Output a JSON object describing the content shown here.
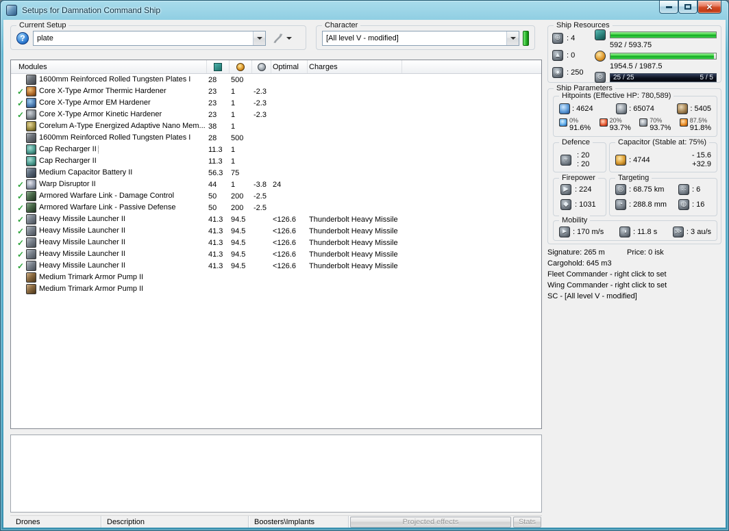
{
  "window": {
    "title": "Setups for Damnation Command Ship"
  },
  "setup_bar": {
    "current_setup_label": "Current Setup",
    "setup_value": "plate",
    "character_label": "Character",
    "character_value": "[All level V - modified]"
  },
  "modules": {
    "columns": {
      "name": "Modules",
      "optimal": "Optimal",
      "charges": "Charges"
    },
    "rows": [
      {
        "active": false,
        "icon": "armor-plate",
        "name": "1600mm Reinforced Rolled Tungsten Plates I",
        "cpu": "28",
        "pg": "500",
        "cap": "",
        "optimal": "",
        "charge": "",
        "focused": false
      },
      {
        "active": true,
        "icon": "hardener-thermic",
        "name": "Core X-Type Armor Thermic Hardener",
        "cpu": "23",
        "pg": "1",
        "cap": "-2.3",
        "optimal": "",
        "charge": "",
        "focused": false
      },
      {
        "active": true,
        "icon": "hardener-em",
        "name": "Core X-Type Armor EM Hardener",
        "cpu": "23",
        "pg": "1",
        "cap": "-2.3",
        "optimal": "",
        "charge": "",
        "focused": false
      },
      {
        "active": true,
        "icon": "hardener-kinetic",
        "name": "Core X-Type Armor Kinetic Hardener",
        "cpu": "23",
        "pg": "1",
        "cap": "-2.3",
        "optimal": "",
        "charge": "",
        "focused": false
      },
      {
        "active": false,
        "icon": "eanm",
        "name": "Corelum A-Type Energized Adaptive Nano Mem...",
        "cpu": "38",
        "pg": "1",
        "cap": "",
        "optimal": "",
        "charge": "",
        "focused": false
      },
      {
        "active": false,
        "icon": "armor-plate",
        "name": "1600mm Reinforced Rolled Tungsten Plates I",
        "cpu": "28",
        "pg": "500",
        "cap": "",
        "optimal": "",
        "charge": "",
        "focused": false
      },
      {
        "active": false,
        "icon": "cap-recharger",
        "name": "Cap Recharger II",
        "cpu": "11.3",
        "pg": "1",
        "cap": "",
        "optimal": "",
        "charge": "",
        "focused": true
      },
      {
        "active": false,
        "icon": "cap-recharger",
        "name": "Cap Recharger II",
        "cpu": "11.3",
        "pg": "1",
        "cap": "",
        "optimal": "",
        "charge": "",
        "focused": false
      },
      {
        "active": false,
        "icon": "cap-battery",
        "name": "Medium Capacitor Battery II",
        "cpu": "56.3",
        "pg": "75",
        "cap": "",
        "optimal": "",
        "charge": "",
        "focused": false
      },
      {
        "active": true,
        "icon": "warp-disruptor",
        "name": "Warp Disruptor II",
        "cpu": "44",
        "pg": "1",
        "cap": "-3.8",
        "optimal": "24",
        "charge": "",
        "focused": false
      },
      {
        "active": true,
        "icon": "warfare-link",
        "name": "Armored Warfare Link - Damage Control",
        "cpu": "50",
        "pg": "200",
        "cap": "-2.5",
        "optimal": "",
        "charge": "",
        "focused": false
      },
      {
        "active": true,
        "icon": "warfare-link",
        "name": "Armored Warfare Link - Passive Defense",
        "cpu": "50",
        "pg": "200",
        "cap": "-2.5",
        "optimal": "",
        "charge": "",
        "focused": false
      },
      {
        "active": true,
        "icon": "missile-launcher",
        "name": "Heavy Missile Launcher II",
        "cpu": "41.3",
        "pg": "94.5",
        "cap": "",
        "optimal": "<126.6",
        "charge": "Thunderbolt Heavy Missile",
        "focused": false
      },
      {
        "active": true,
        "icon": "missile-launcher",
        "name": "Heavy Missile Launcher II",
        "cpu": "41.3",
        "pg": "94.5",
        "cap": "",
        "optimal": "<126.6",
        "charge": "Thunderbolt Heavy Missile",
        "focused": false
      },
      {
        "active": true,
        "icon": "missile-launcher",
        "name": "Heavy Missile Launcher II",
        "cpu": "41.3",
        "pg": "94.5",
        "cap": "",
        "optimal": "<126.6",
        "charge": "Thunderbolt Heavy Missile",
        "focused": false
      },
      {
        "active": true,
        "icon": "missile-launcher",
        "name": "Heavy Missile Launcher II",
        "cpu": "41.3",
        "pg": "94.5",
        "cap": "",
        "optimal": "<126.6",
        "charge": "Thunderbolt Heavy Missile",
        "focused": false
      },
      {
        "active": true,
        "icon": "missile-launcher",
        "name": "Heavy Missile Launcher II",
        "cpu": "41.3",
        "pg": "94.5",
        "cap": "",
        "optimal": "<126.6",
        "charge": "Thunderbolt Heavy Missile",
        "focused": false
      },
      {
        "active": false,
        "icon": "rig",
        "name": "Medium Trimark Armor Pump II",
        "cpu": "",
        "pg": "",
        "cap": "",
        "optimal": "",
        "charge": "",
        "focused": false
      },
      {
        "active": false,
        "icon": "rig",
        "name": "Medium Trimark Armor Pump II",
        "cpu": "",
        "pg": "",
        "cap": "",
        "optimal": "",
        "charge": "",
        "focused": false
      }
    ]
  },
  "ship_resources": {
    "label": "Ship Resources",
    "turret_hardpoints": ": 4",
    "launcher_hardpoints": ": 0",
    "calibration": ": 250",
    "cpu_text": "592 / 593.75",
    "powergrid_text": "1954.5 / 1987.5",
    "drone_text": "25 / 25",
    "slots_text": "5 / 5"
  },
  "ship_parameters": {
    "label": "Ship Parameters",
    "hitpoints": {
      "label": "Hitpoints (Effective HP: 780,589)",
      "shield": ": 4624",
      "armor": ": 65074",
      "structure": ": 5405",
      "resists": [
        {
          "type": "em",
          "top": "0%",
          "bottom": "91.6%"
        },
        {
          "type": "thermal",
          "top": "20%",
          "bottom": "93.7%"
        },
        {
          "type": "kinetic",
          "top": "70%",
          "bottom": "93.7%"
        },
        {
          "type": "explosive",
          "top": "87.5%",
          "bottom": "91.8%"
        }
      ]
    },
    "defence": {
      "label": "Defence",
      "value_top": ": 20",
      "value_bottom": ": 20"
    },
    "capacitor": {
      "label": "Capacitor (Stable at: 75%)",
      "amount": ": 4744",
      "usage": "- 15.6",
      "recharge": "+32.9"
    },
    "firepower": {
      "label": "Firepower",
      "volley": ": 224",
      "dps": ": 1031"
    },
    "targeting": {
      "label": "Targeting",
      "range": ": 68.75 km",
      "max_targets": ": 6",
      "scan_resolution": ": 288.8 mm",
      "sensor_strength": ": 16"
    },
    "mobility": {
      "label": "Mobility",
      "speed": ": 170 m/s",
      "align_time": ": 11.8 s",
      "warp_speed": ": 3 au/s"
    }
  },
  "summary": {
    "signature": "Signature: 265 m",
    "price": "Price: 0 isk",
    "cargohold": "Cargohold: 645 m3",
    "fleet_commander": "Fleet Commander - right click to set",
    "wing_commander": "Wing Commander - right click to set",
    "squad_commander": "SC - [All level V - modified]"
  },
  "bottom_bar": {
    "drones": "Drones",
    "description": "Description",
    "boosters": "Boosters\\Implants",
    "projected_effects": "Projected effects",
    "stats": "Stats"
  }
}
